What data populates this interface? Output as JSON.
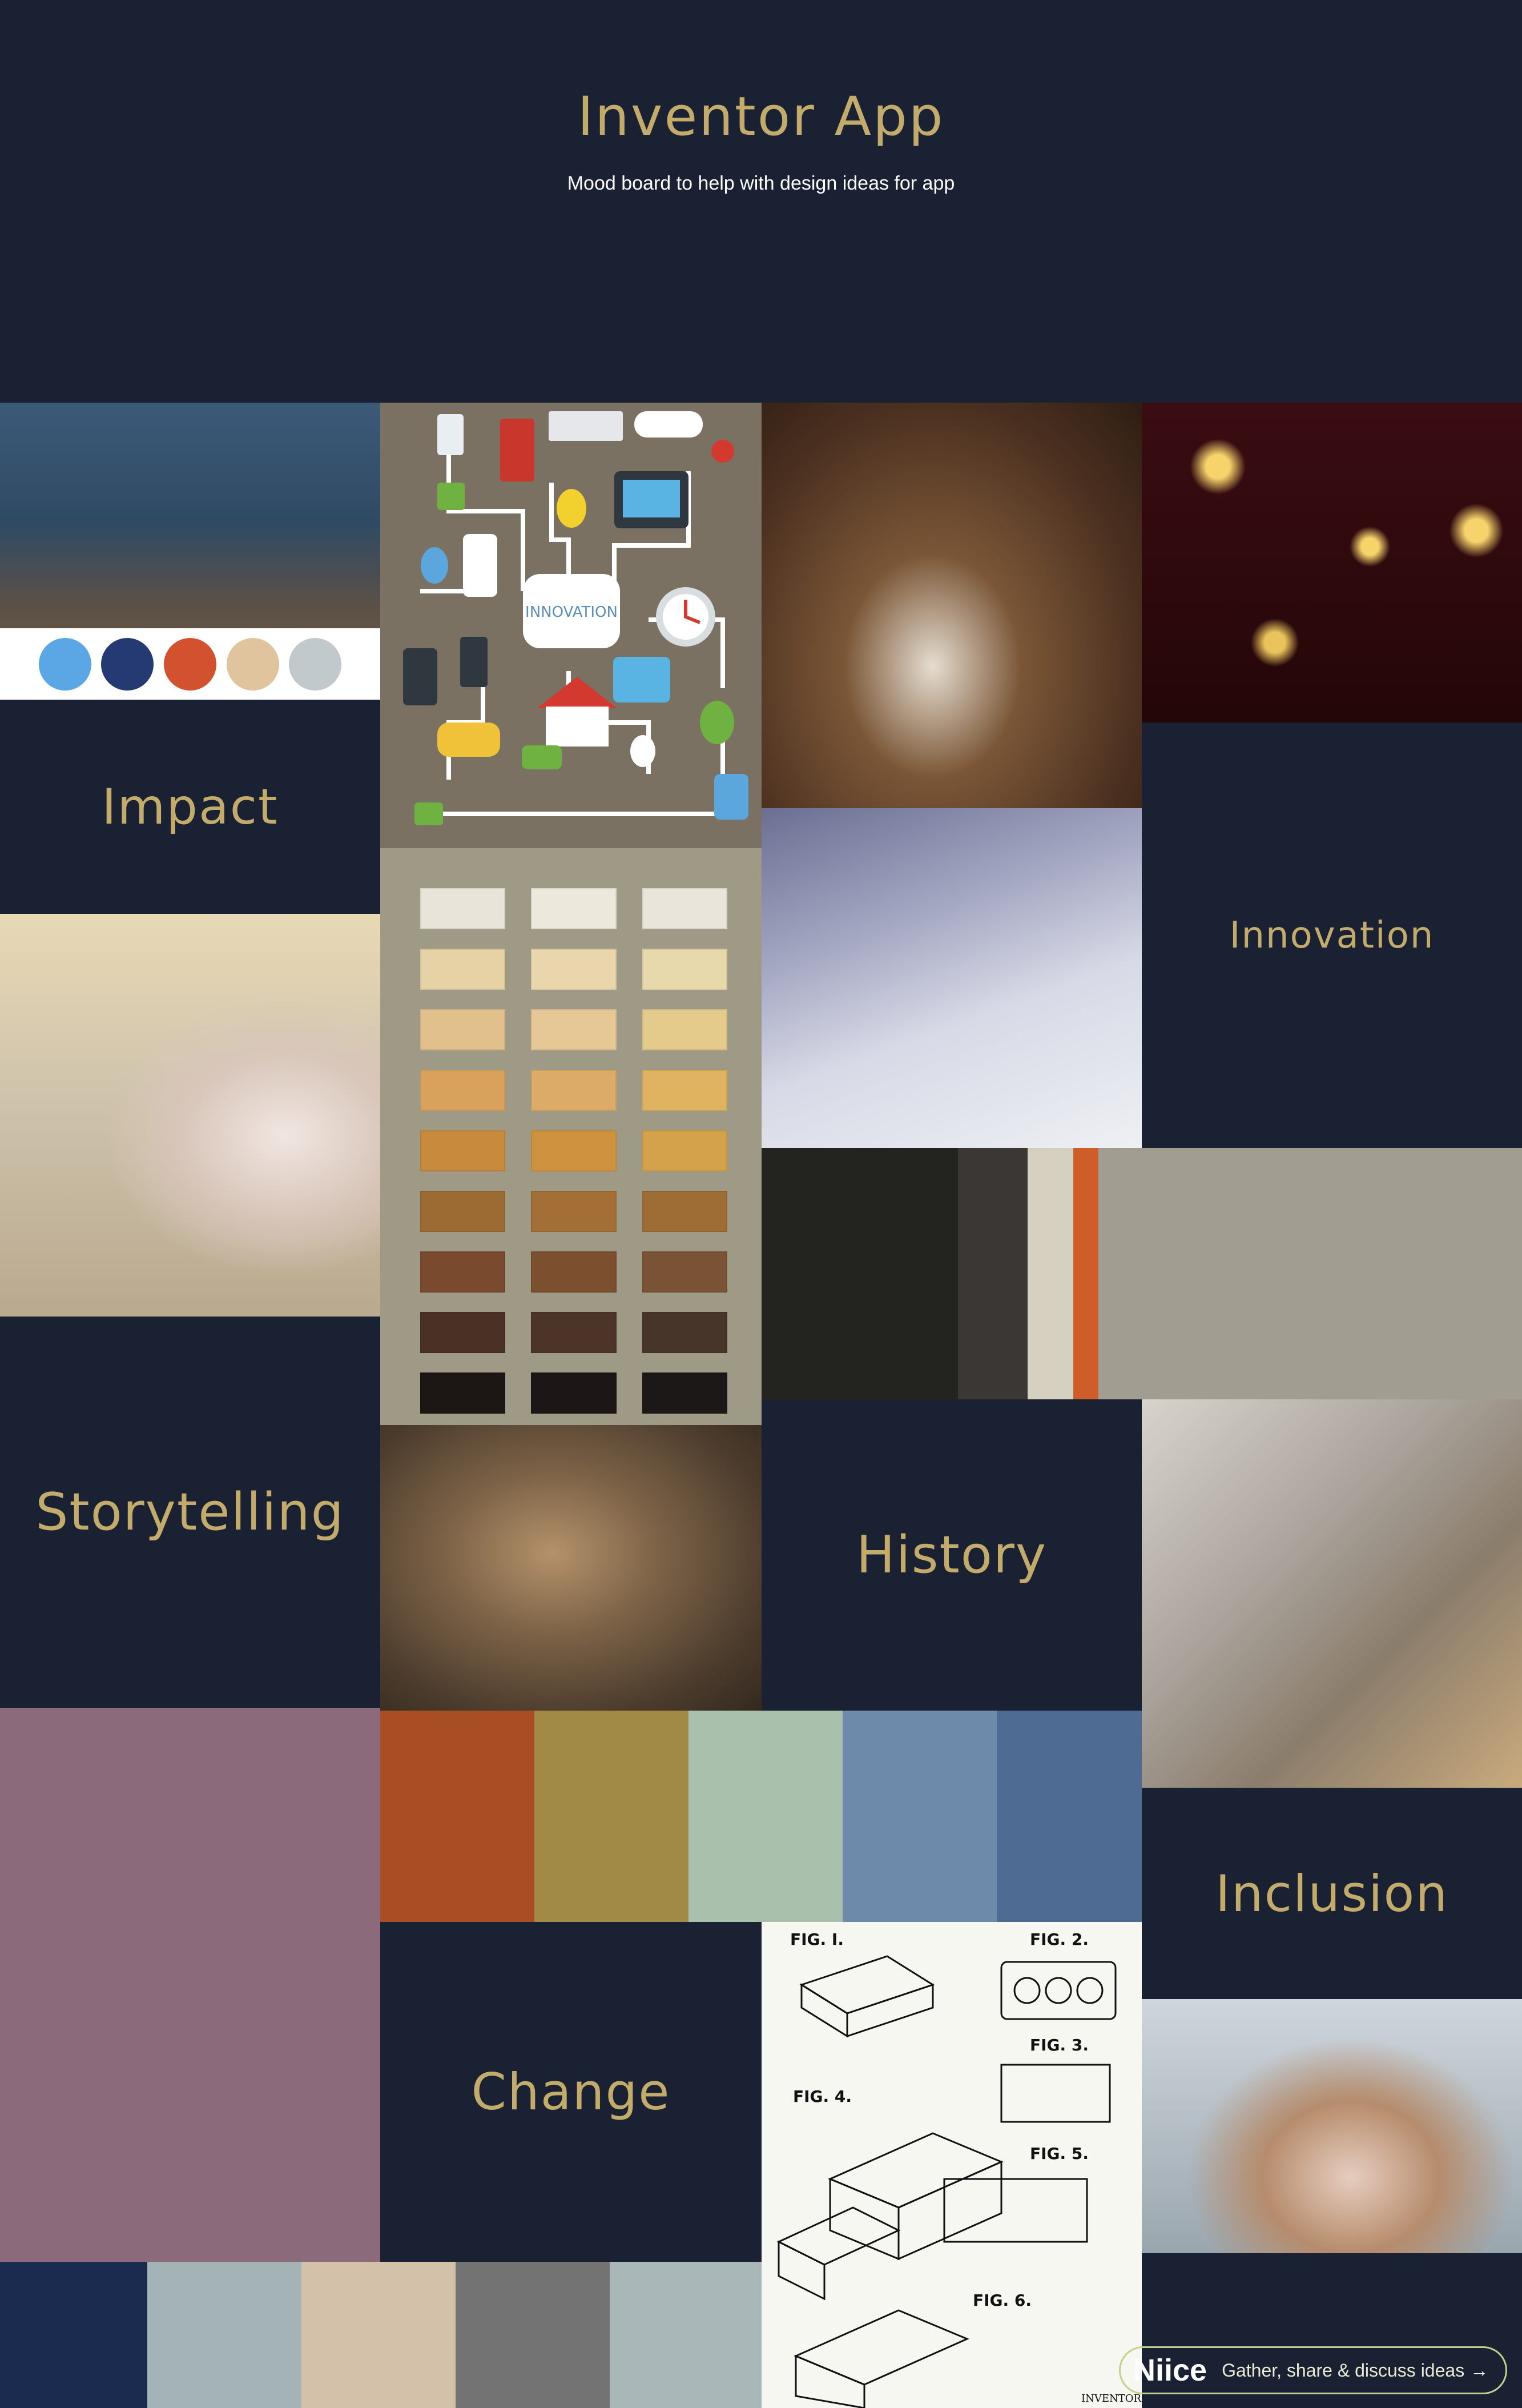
{
  "header": {
    "title": "Inventor App",
    "subtitle": "Mood board to help with design ideas for app"
  },
  "keywords": {
    "impact": "Impact",
    "innovation": "Innovation",
    "storytelling": "Storytelling",
    "history": "History",
    "inclusion": "Inclusion",
    "change": "Change"
  },
  "graphic": {
    "innovation_label": "INNOVATION"
  },
  "palettes": {
    "character_dots": [
      "#5ba6e4",
      "#253a72",
      "#d2512f",
      "#e0c49e",
      "#c2c9cc"
    ],
    "stripes": [
      "#23231f",
      "#3b3734",
      "#d6d0c0",
      "#cf5d2a",
      "#a29d91"
    ],
    "warm_row": [
      "#a84d24",
      "#a18a46",
      "#a9c0ad",
      "#6e8aab",
      "#4e6c93"
    ],
    "mauve": "#8b6b7b",
    "bottom_row": [
      "#1b2a4f",
      "#a4b3b6",
      "#d3c1aa",
      "#737373",
      "#a9b7b9"
    ],
    "color_chart_rows": [
      [
        "#e8e4d9",
        "#ede8dc",
        "#e9e5da"
      ],
      [
        "#e7d2a5",
        "#e9d6ac",
        "#e8d9ac"
      ],
      [
        "#e2c08c",
        "#e6c796",
        "#e4cb8c"
      ],
      [
        "#d8a25d",
        "#dcab67",
        "#dfb35f"
      ],
      [
        "#c88a3d",
        "#cf9340",
        "#d4a24b"
      ],
      [
        "#9c6a33",
        "#a36f36",
        "#9e6c35"
      ],
      [
        "#7a4a2e",
        "#7c4f2f",
        "#7a5235"
      ],
      [
        "#4b3025",
        "#4c3428",
        "#473529"
      ],
      [
        "#1c1615",
        "#1c1716",
        "#1c1817"
      ]
    ]
  },
  "patent": {
    "fig1": "FIG. I.",
    "fig2": "FIG. 2.",
    "fig3": "FIG. 3.",
    "fig4": "FIG. 4.",
    "fig5": "FIG. 5.",
    "fig6": "FIG. 6.",
    "inventor": "INVENTOR"
  },
  "badge": {
    "brand": "Niice",
    "tagline": "Gather, share & discuss ideas",
    "arrow": "→"
  }
}
